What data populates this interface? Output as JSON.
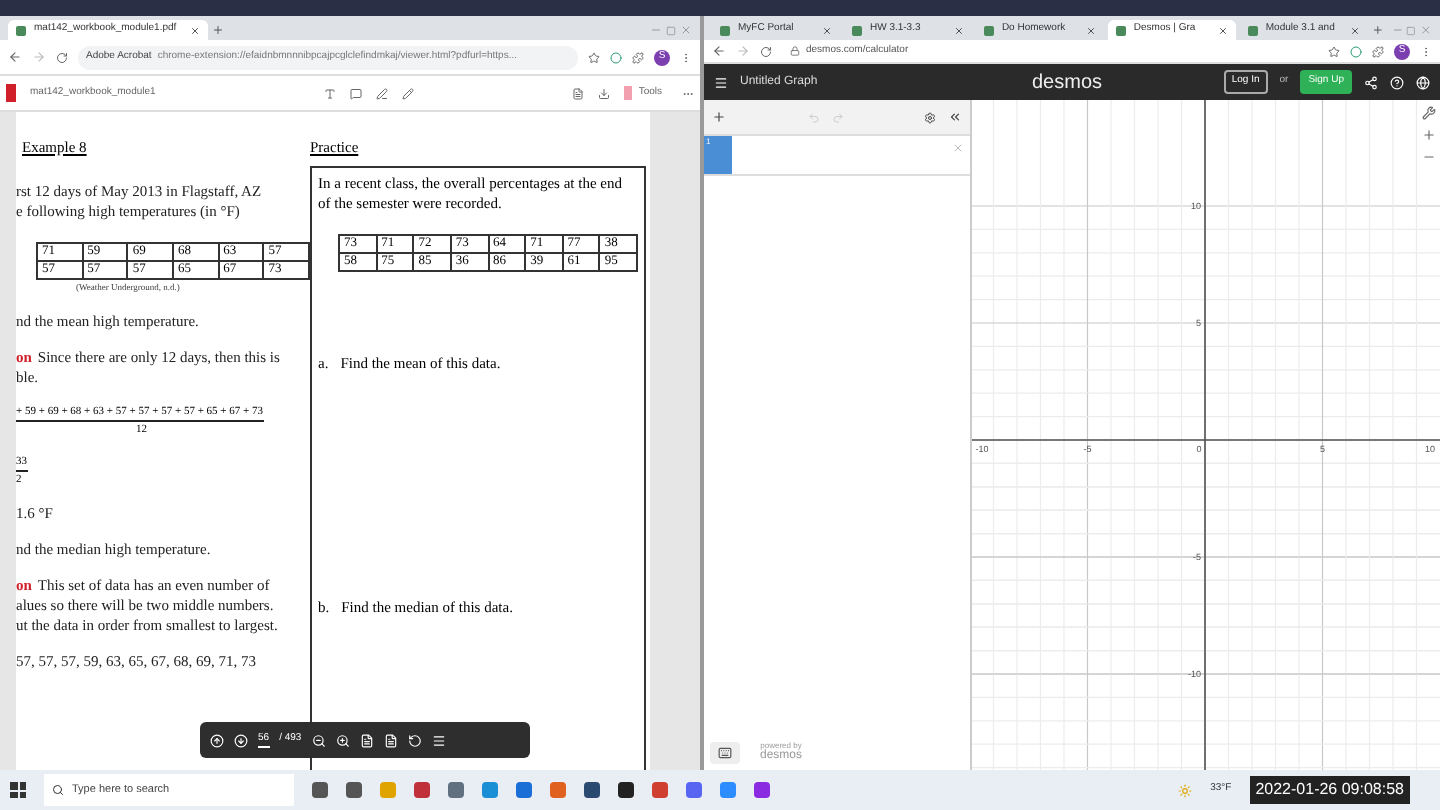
{
  "left_browser": {
    "tabs": [
      {
        "title": "mat142_workbook_module1.pdf",
        "selected": true
      }
    ],
    "address": {
      "site": "Adobe Acrobat",
      "url": "chrome-extension://efaidnbmnnnibpcajpcglclefindmkaj/viewer.html?pdfurl=https..."
    },
    "avatar_letter": "S",
    "acrobat_toolbar": {
      "filename": "mat142_workbook_module1",
      "tools_label": "Tools"
    }
  },
  "pdf": {
    "example": {
      "heading": "Example 8",
      "blocks": [
        {
          "kind": "text",
          "lines": [
            "rst 12 days of May 2013 in Flagstaff, AZ",
            "e following high temperatures (in °F)"
          ]
        },
        {
          "kind": "table",
          "rows": [
            [
              "71",
              "59",
              "69",
              "68",
              "63",
              "57"
            ],
            [
              "57",
              "57",
              "57",
              "65",
              "67",
              "73"
            ]
          ]
        },
        {
          "kind": "source",
          "lines": [
            "(Weather Underground, n.d.)"
          ]
        },
        {
          "kind": "text",
          "lines": [
            "nd the mean high temperature."
          ]
        },
        {
          "kind": "solution",
          "label": "on",
          "lines": [
            "Since there are only 12 days, then this is",
            "ble."
          ]
        },
        {
          "kind": "fraction",
          "lines": [
            "+ 59 + 69 + 68 + 63 + 57 + 57 + 57 + 57 + 65 + 67 + 73",
            "12"
          ]
        },
        {
          "kind": "fraction",
          "lines": [
            "33",
            "2"
          ]
        },
        {
          "kind": "text",
          "lines": [
            "1.6 °F"
          ]
        },
        {
          "kind": "text",
          "lines": [
            "nd the median high temperature."
          ]
        },
        {
          "kind": "solution",
          "label": "on",
          "lines": [
            "This set of data has an even number of",
            "alues so there will be two middle numbers.",
            "ut the data in order from smallest to largest."
          ]
        },
        {
          "kind": "text",
          "lines": [
            "57, 57, 57, 59, 63, 65, 67, 68, 69, 71, 73"
          ]
        }
      ]
    },
    "practice": {
      "heading": "Practice",
      "intro": "In a recent class, the overall percentages at the end of the semester were recorded.",
      "table": [
        [
          "73",
          "71",
          "72",
          "73",
          "64",
          "71",
          "77",
          "38"
        ],
        [
          "58",
          "75",
          "85",
          "36",
          "86",
          "39",
          "61",
          "95"
        ]
      ],
      "questions": [
        {
          "label": "a.",
          "text": "Find the mean of this data."
        },
        {
          "label": "b.",
          "text": "Find the median of this data."
        }
      ]
    },
    "page_toolbar": {
      "page": "56",
      "total": "/ 493"
    }
  },
  "right_browser": {
    "tabs": [
      {
        "title": "MyFC Portal",
        "selected": false
      },
      {
        "title": "HW 3.1-3.3",
        "selected": false
      },
      {
        "title": "Do Homework",
        "selected": false
      },
      {
        "title": "Desmos | Gra",
        "selected": true
      },
      {
        "title": "Module 3.1 and",
        "selected": false
      }
    ],
    "address": {
      "url": "desmos.com/calculator"
    },
    "avatar_letter": "S"
  },
  "desmos": {
    "title": "Untitled Graph",
    "logo": "desmos",
    "login": "Log In",
    "or": "or",
    "signup": "Sign Up",
    "expression": {
      "index": "1"
    },
    "footer": {
      "caption": "powered by",
      "logo": "desmos"
    },
    "x_ticks": [
      "-10",
      "-5",
      "0",
      "5",
      "10"
    ],
    "y_ticks": [
      "10",
      "5",
      "-5",
      "-10"
    ]
  },
  "taskbar": {
    "search_placeholder": "Type here to search",
    "weather": "33°F",
    "timestamp": "2022-01-26 09:08:58"
  }
}
